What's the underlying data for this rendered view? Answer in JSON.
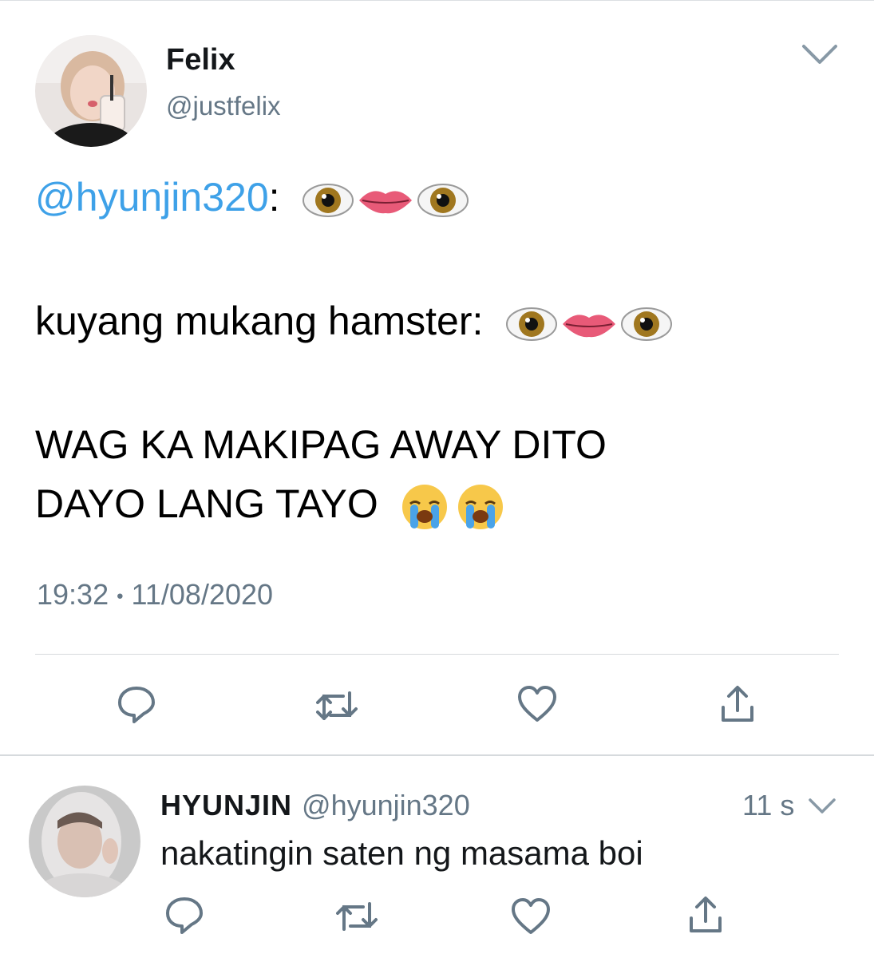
{
  "tweet": {
    "author_name": "Felix",
    "author_handle": "@justfelix",
    "mention": "@hyunjin320",
    "line1_suffix": ":",
    "line2": "kuyang mukang hamster:",
    "line3": "WAG KA MAKIPAG AWAY DITO",
    "line4": "DAYO LANG TAYO",
    "time": "19:32",
    "separator": "•",
    "date": "11/08/2020",
    "emojis_line1": [
      "eye",
      "mouth",
      "eye"
    ],
    "emojis_line2": [
      "eye",
      "mouth",
      "eye"
    ],
    "emojis_line4": [
      "loudly-crying-face",
      "loudly-crying-face"
    ]
  },
  "actions": [
    "reply-icon",
    "retweet-icon",
    "like-icon",
    "share-icon"
  ],
  "reply": {
    "author_name": "HYUNJIN",
    "author_handle": "@hyunjin320",
    "time_ago": "11 s",
    "text": "nakatingin saten ng masama boi"
  },
  "colors": {
    "mention_blue": "#3ea1e8",
    "secondary_gray": "#657786",
    "icon_gray": "#657786",
    "divider": "#d6dadd"
  }
}
